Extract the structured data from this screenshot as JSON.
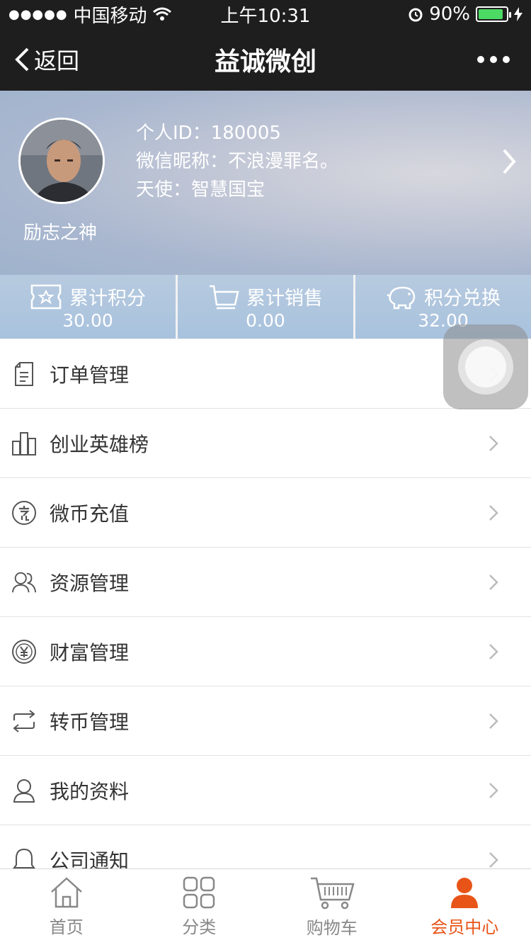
{
  "status_bar": {
    "carrier": "中国移动",
    "time": "上午10:31",
    "battery": "90%",
    "battery_level": 0.9
  },
  "nav": {
    "back_label": "返回",
    "title": "益诚微创"
  },
  "profile": {
    "nickname_display": "励志之神",
    "id_line": "个人ID：180005",
    "wechat_line": "微信昵称：不浪漫罪名。",
    "angel_line": "天使：智慧国宝"
  },
  "stats": [
    {
      "label": "累计积分",
      "value": "30.00",
      "icon": "badge-icon"
    },
    {
      "label": "累计销售",
      "value": "0.00",
      "icon": "cart-outline-icon"
    },
    {
      "label": "积分兑换",
      "value": "32.00",
      "icon": "piggy-bank-icon"
    }
  ],
  "menu": [
    {
      "label": "订单管理",
      "icon": "document-icon"
    },
    {
      "label": "创业英雄榜",
      "icon": "bar-chart-icon"
    },
    {
      "label": "微币充值",
      "icon": "recharge-icon"
    },
    {
      "label": "资源管理",
      "icon": "users-icon"
    },
    {
      "label": "财富管理",
      "icon": "yen-coin-icon"
    },
    {
      "label": "转币管理",
      "icon": "transfer-icon"
    },
    {
      "label": "我的资料",
      "icon": "user-icon"
    },
    {
      "label": "公司通知",
      "icon": "bell-icon"
    }
  ],
  "tabs": [
    {
      "label": "首页",
      "icon": "home-icon",
      "active": false
    },
    {
      "label": "分类",
      "icon": "grid-icon",
      "active": false
    },
    {
      "label": "购物车",
      "icon": "cart-icon",
      "active": false
    },
    {
      "label": "会员中心",
      "icon": "member-icon",
      "active": true
    }
  ],
  "colors": {
    "bar_bg": "#1e1e1e",
    "accent": "#e85418",
    "stat_bg": "#a8c2de"
  }
}
